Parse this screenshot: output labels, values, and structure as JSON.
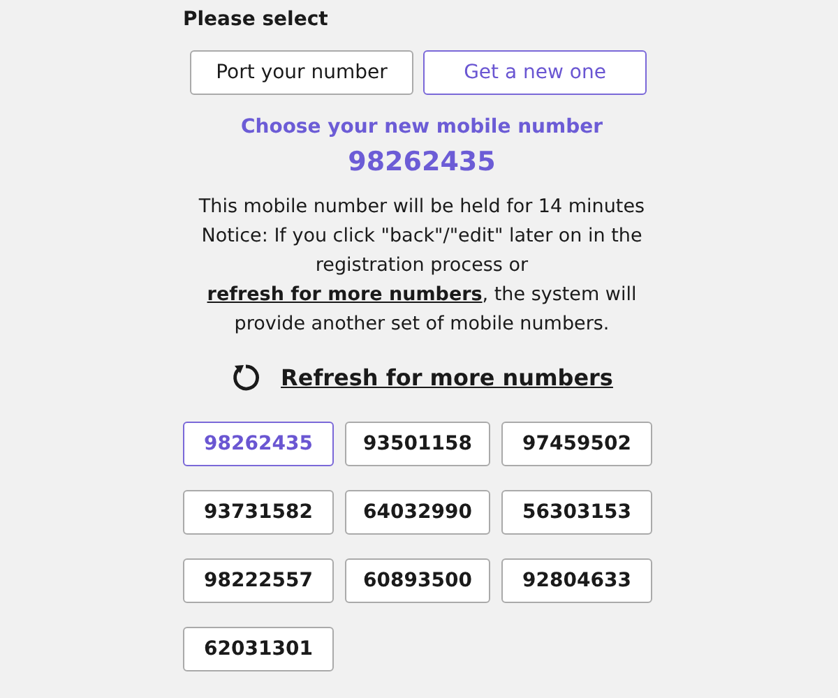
{
  "prompt": "Please select",
  "modes": [
    {
      "label": "Port your number",
      "selected": false
    },
    {
      "label": "Get a new one",
      "selected": true
    }
  ],
  "heading": "Choose your new mobile number",
  "chosen_number": "98262435",
  "hold_text": "This mobile number will be held for 14 minutes",
  "notice": {
    "before": "Notice: If you click \"back\"/\"edit\" later on in the registration process or ",
    "link": "refresh for more numbers",
    "after": ", the system will provide another set of mobile numbers."
  },
  "refresh_link": "Refresh for more numbers",
  "numbers": [
    {
      "label": "98262435",
      "selected": true
    },
    {
      "label": "93501158",
      "selected": false
    },
    {
      "label": "97459502",
      "selected": false
    },
    {
      "label": "93731582",
      "selected": false
    },
    {
      "label": "64032990",
      "selected": false
    },
    {
      "label": "56303153",
      "selected": false
    },
    {
      "label": "98222557",
      "selected": false
    },
    {
      "label": "60893500",
      "selected": false
    },
    {
      "label": "92804633",
      "selected": false
    },
    {
      "label": "62031301",
      "selected": false
    }
  ]
}
